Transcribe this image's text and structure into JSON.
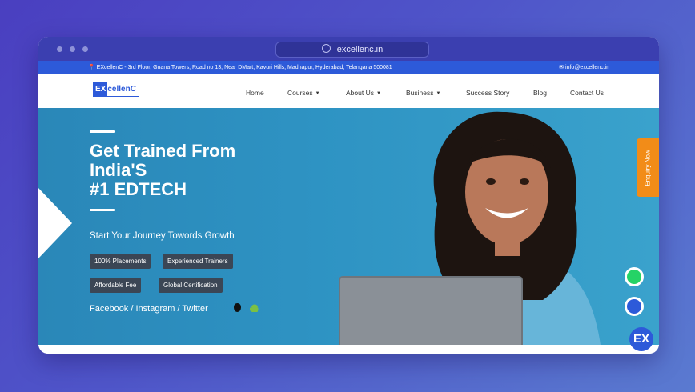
{
  "browser": {
    "url": "excellenc.in",
    "dots": [
      "dot",
      "dot",
      "dot"
    ]
  },
  "topbar": {
    "address": "EXcellenC - 3rd Floor, Gnana Towers, Road no 13, Near DMart, Kavuri Hills, Madhapur, Hyderabad, Telangana 500081",
    "email": "info@excellenc.in"
  },
  "logo": {
    "ex": "EX",
    "rest": "cellenC"
  },
  "nav": {
    "items": [
      "Home",
      "Courses",
      "About Us",
      "Business",
      "Success Story",
      "Blog",
      "Contact Us"
    ]
  },
  "hero": {
    "headline": [
      "Get Trained From",
      "India'S",
      "#1 EDTECH"
    ],
    "tagline": "Start Your Journey Towords Growth",
    "chips": [
      "100% Placements",
      "Experienced Trainers",
      "Affordable Fee",
      "Global Certification"
    ],
    "social": "Facebook / Instagram / Twitter"
  },
  "widgets": {
    "enquiry": "Enquiry Now",
    "badge": "EX"
  },
  "colors": {
    "brand_blue": "#2d5ad9",
    "hero_blue": "#2e93c3",
    "enquiry_orange": "#f28c18",
    "whatsapp_green": "#25d366"
  }
}
